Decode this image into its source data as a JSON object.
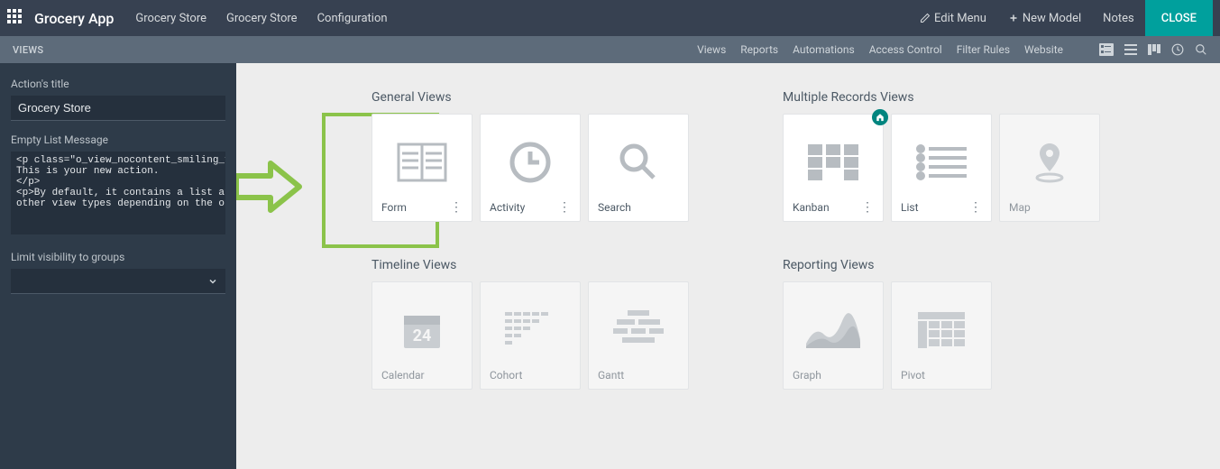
{
  "topbar": {
    "brand": "Grocery App",
    "nav": [
      "Grocery Store",
      "Grocery Store",
      "Configuration"
    ],
    "edit_menu": "Edit Menu",
    "new_model": "New Model",
    "notes": "Notes",
    "close": "CLOSE"
  },
  "subbar": {
    "left": "VIEWS",
    "links": [
      "Views",
      "Reports",
      "Automations",
      "Access Control",
      "Filter Rules",
      "Website"
    ]
  },
  "sidebar": {
    "action_title_label": "Action's title",
    "action_title_value": "Grocery Store",
    "empty_list_label": "Empty List Message",
    "empty_list_value": "<p class=\"o_view_nocontent_smiling_face\">\nThis is your new action.\n</p>\n<p>By default, it contains a list and a form view and possibly\nother view types depending on the options you chose for your model.",
    "visibility_label": "Limit visibility to groups"
  },
  "sections": {
    "general": {
      "title": "General Views",
      "cards": [
        {
          "label": "Form",
          "has_menu": true
        },
        {
          "label": "Activity",
          "has_menu": true
        },
        {
          "label": "Search",
          "has_menu": false
        }
      ]
    },
    "multiple": {
      "title": "Multiple Records Views",
      "cards": [
        {
          "label": "Kanban",
          "has_menu": true,
          "home": true
        },
        {
          "label": "List",
          "has_menu": true
        },
        {
          "label": "Map",
          "disabled": true
        }
      ]
    },
    "timeline": {
      "title": "Timeline Views",
      "cards": [
        {
          "label": "Calendar"
        },
        {
          "label": "Cohort"
        },
        {
          "label": "Gantt"
        }
      ]
    },
    "reporting": {
      "title": "Reporting Views",
      "cards": [
        {
          "label": "Graph"
        },
        {
          "label": "Pivot"
        }
      ]
    }
  }
}
